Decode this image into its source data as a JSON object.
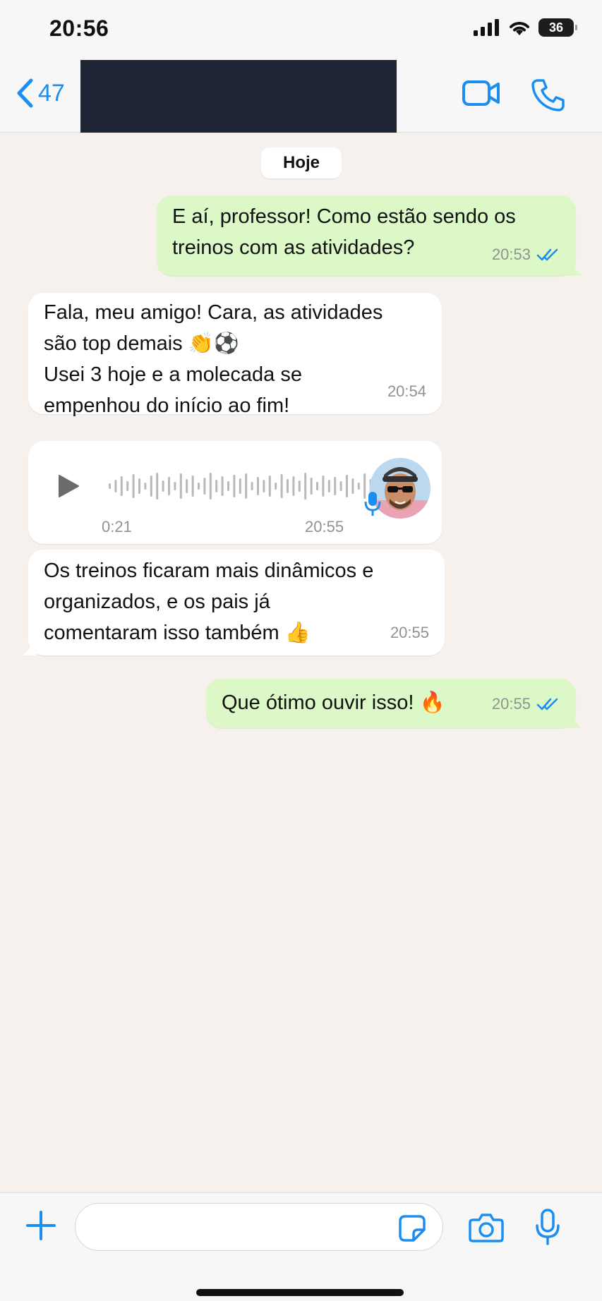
{
  "status": {
    "time": "20:56",
    "battery": "36"
  },
  "header": {
    "back_count": "47"
  },
  "date_chip": "Hoje",
  "messages": [
    {
      "direction": "out",
      "text": "E aí, professor! Como estão sendo os\ntreinos com as atividades?",
      "time": "20:53",
      "read": true
    },
    {
      "direction": "in",
      "text": "Fala, meu amigo! Cara, as atividades\nsão top demais 👏⚽\nUsei 3 hoje e a molecada se\nempenhou do início ao fim!",
      "time": "20:54"
    },
    {
      "direction": "in",
      "type": "voice",
      "duration": "0:21",
      "time": "20:55"
    },
    {
      "direction": "in",
      "text": "Os treinos ficaram mais dinâmicos e\norganizados, e os pais já\ncomentaram isso também 👍",
      "time": "20:55"
    },
    {
      "direction": "out",
      "text": "Que ótimo ouvir isso! 🔥",
      "time": "20:55",
      "read": true
    }
  ],
  "input": {
    "placeholder": ""
  },
  "colors": {
    "accent": "#1b8ef2",
    "outgoing": "#dbf8c6",
    "incoming": "#ffffff",
    "background": "#f6f1ec"
  }
}
